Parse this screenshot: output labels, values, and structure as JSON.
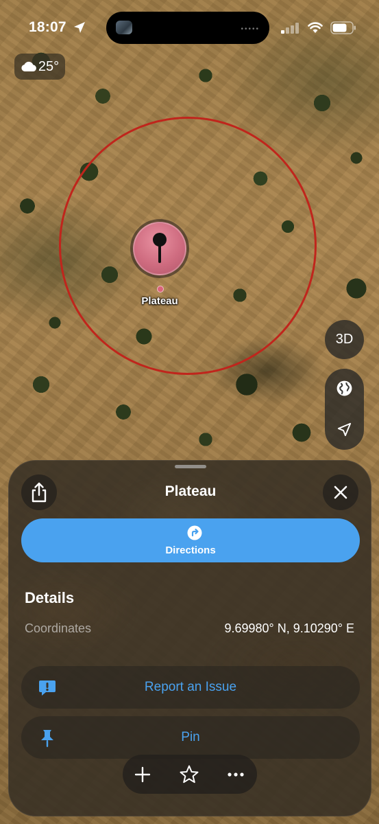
{
  "status_bar": {
    "time": "18:07",
    "icons": [
      "location-arrow-icon",
      "cellular-signal-icon",
      "wifi-icon",
      "battery-icon"
    ]
  },
  "weather": {
    "icon": "cloud-icon",
    "temperature": "25°"
  },
  "map": {
    "pin_label": "Plateau",
    "radius_ring_color": "#c0251c",
    "pin_color": "#cf6c80",
    "controls": {
      "three_d_label": "3D",
      "globe_icon": "globe-icon",
      "locate_icon": "location-arrow-icon"
    }
  },
  "sheet": {
    "title": "Plateau",
    "share_icon": "share-icon",
    "close_icon": "close-icon",
    "directions": {
      "label": "Directions",
      "icon": "turn-right-arrow-icon",
      "color": "#4aa2ef"
    },
    "details": {
      "heading": "Details",
      "coordinates_label": "Coordinates",
      "coordinates_value": "9.69980° N, 9.10290° E"
    },
    "actions": [
      {
        "label": "Report an Issue",
        "icon": "exclamation-bubble-icon"
      },
      {
        "label": "Pin",
        "icon": "pushpin-icon"
      }
    ]
  },
  "toolbar": {
    "buttons": [
      "plus-icon",
      "star-icon",
      "ellipsis-icon"
    ]
  }
}
